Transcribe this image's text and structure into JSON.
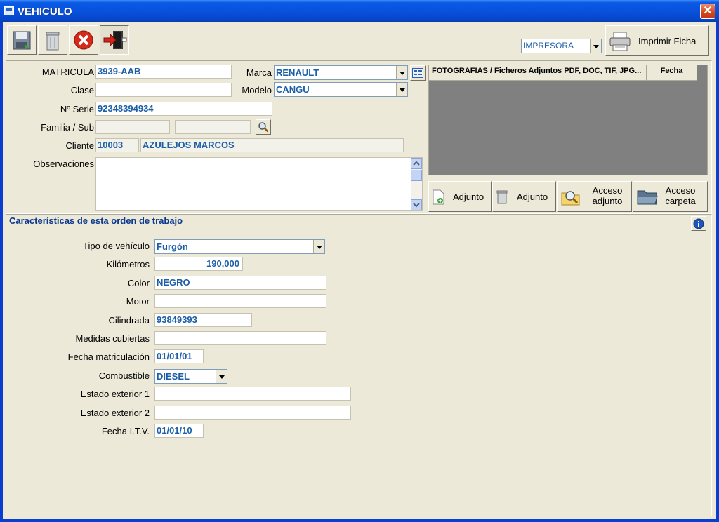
{
  "window": {
    "title": "VEHICULO",
    "close_glyph": "✕",
    "accent": "#0a3ed0"
  },
  "toolbar": {
    "tools": [
      {
        "name": "save",
        "icon": "floppy-disk-icon"
      },
      {
        "name": "delete",
        "icon": "trash-can-icon"
      },
      {
        "name": "cancel",
        "icon": "red-x-icon"
      },
      {
        "name": "exit",
        "icon": "exit-door-icon"
      }
    ],
    "printer_select": "IMPRESORA",
    "print_label": "Imprimir Ficha"
  },
  "vehicle": {
    "matricula_label": "MATRICULA",
    "matricula": "3939-AAB",
    "marca_label": "Marca",
    "marca": "RENAULT",
    "clase_label": "Clase",
    "clase": "",
    "modelo_label": "Modelo",
    "modelo": "CANGU",
    "serie_label": "Nº Serie",
    "serie": "92348394934",
    "familia_label": "Familia / Sub",
    "familia": "",
    "subfamilia": "",
    "cliente_label": "Cliente",
    "cliente_codigo": "10003",
    "cliente_nombre": "AZULEJOS MARCOS",
    "observaciones_label": "Observaciones",
    "observaciones": ""
  },
  "attachments": {
    "col_files": "FOTOGRAFIAS / Ficheros Adjuntos  PDF, DOC, TIF, JPG...",
    "col_date": "Fecha",
    "buttons": [
      {
        "label": "Adjunto",
        "icon": "add-attachment-icon"
      },
      {
        "label": "Adjunto",
        "icon": "delete-attachment-icon"
      },
      {
        "label": "Acceso adjunto",
        "line1": "Acceso",
        "line2": "adjunto",
        "icon": "magnifier-folder-icon"
      },
      {
        "label": "Acceso carpeta",
        "line1": "Acceso",
        "line2": "carpeta",
        "icon": "open-folder-icon"
      }
    ]
  },
  "characteristics": {
    "title": "Características de esta orden de trabajo",
    "tipo_label": "Tipo de vehículo",
    "tipo": "Furgón",
    "km_label": "Kilómetros",
    "km": "190,000",
    "color_label": "Color",
    "color": "NEGRO",
    "motor_label": "Motor",
    "motor": "",
    "cilindrada_label": "Cilindrada",
    "cilindrada": "93849393",
    "medidas_label": "Medidas cubiertas",
    "medidas": "",
    "fecha_mat_label": "Fecha matriculación",
    "fecha_mat": "01/01/01",
    "combustible_label": "Combustible",
    "combustible": "DIESEL",
    "estado1_label": "Estado exterior 1",
    "estado1": "",
    "estado2_label": "Estado exterior 2",
    "estado2": "",
    "itv_label": "Fecha I.T.V.",
    "itv": "01/01/10"
  }
}
